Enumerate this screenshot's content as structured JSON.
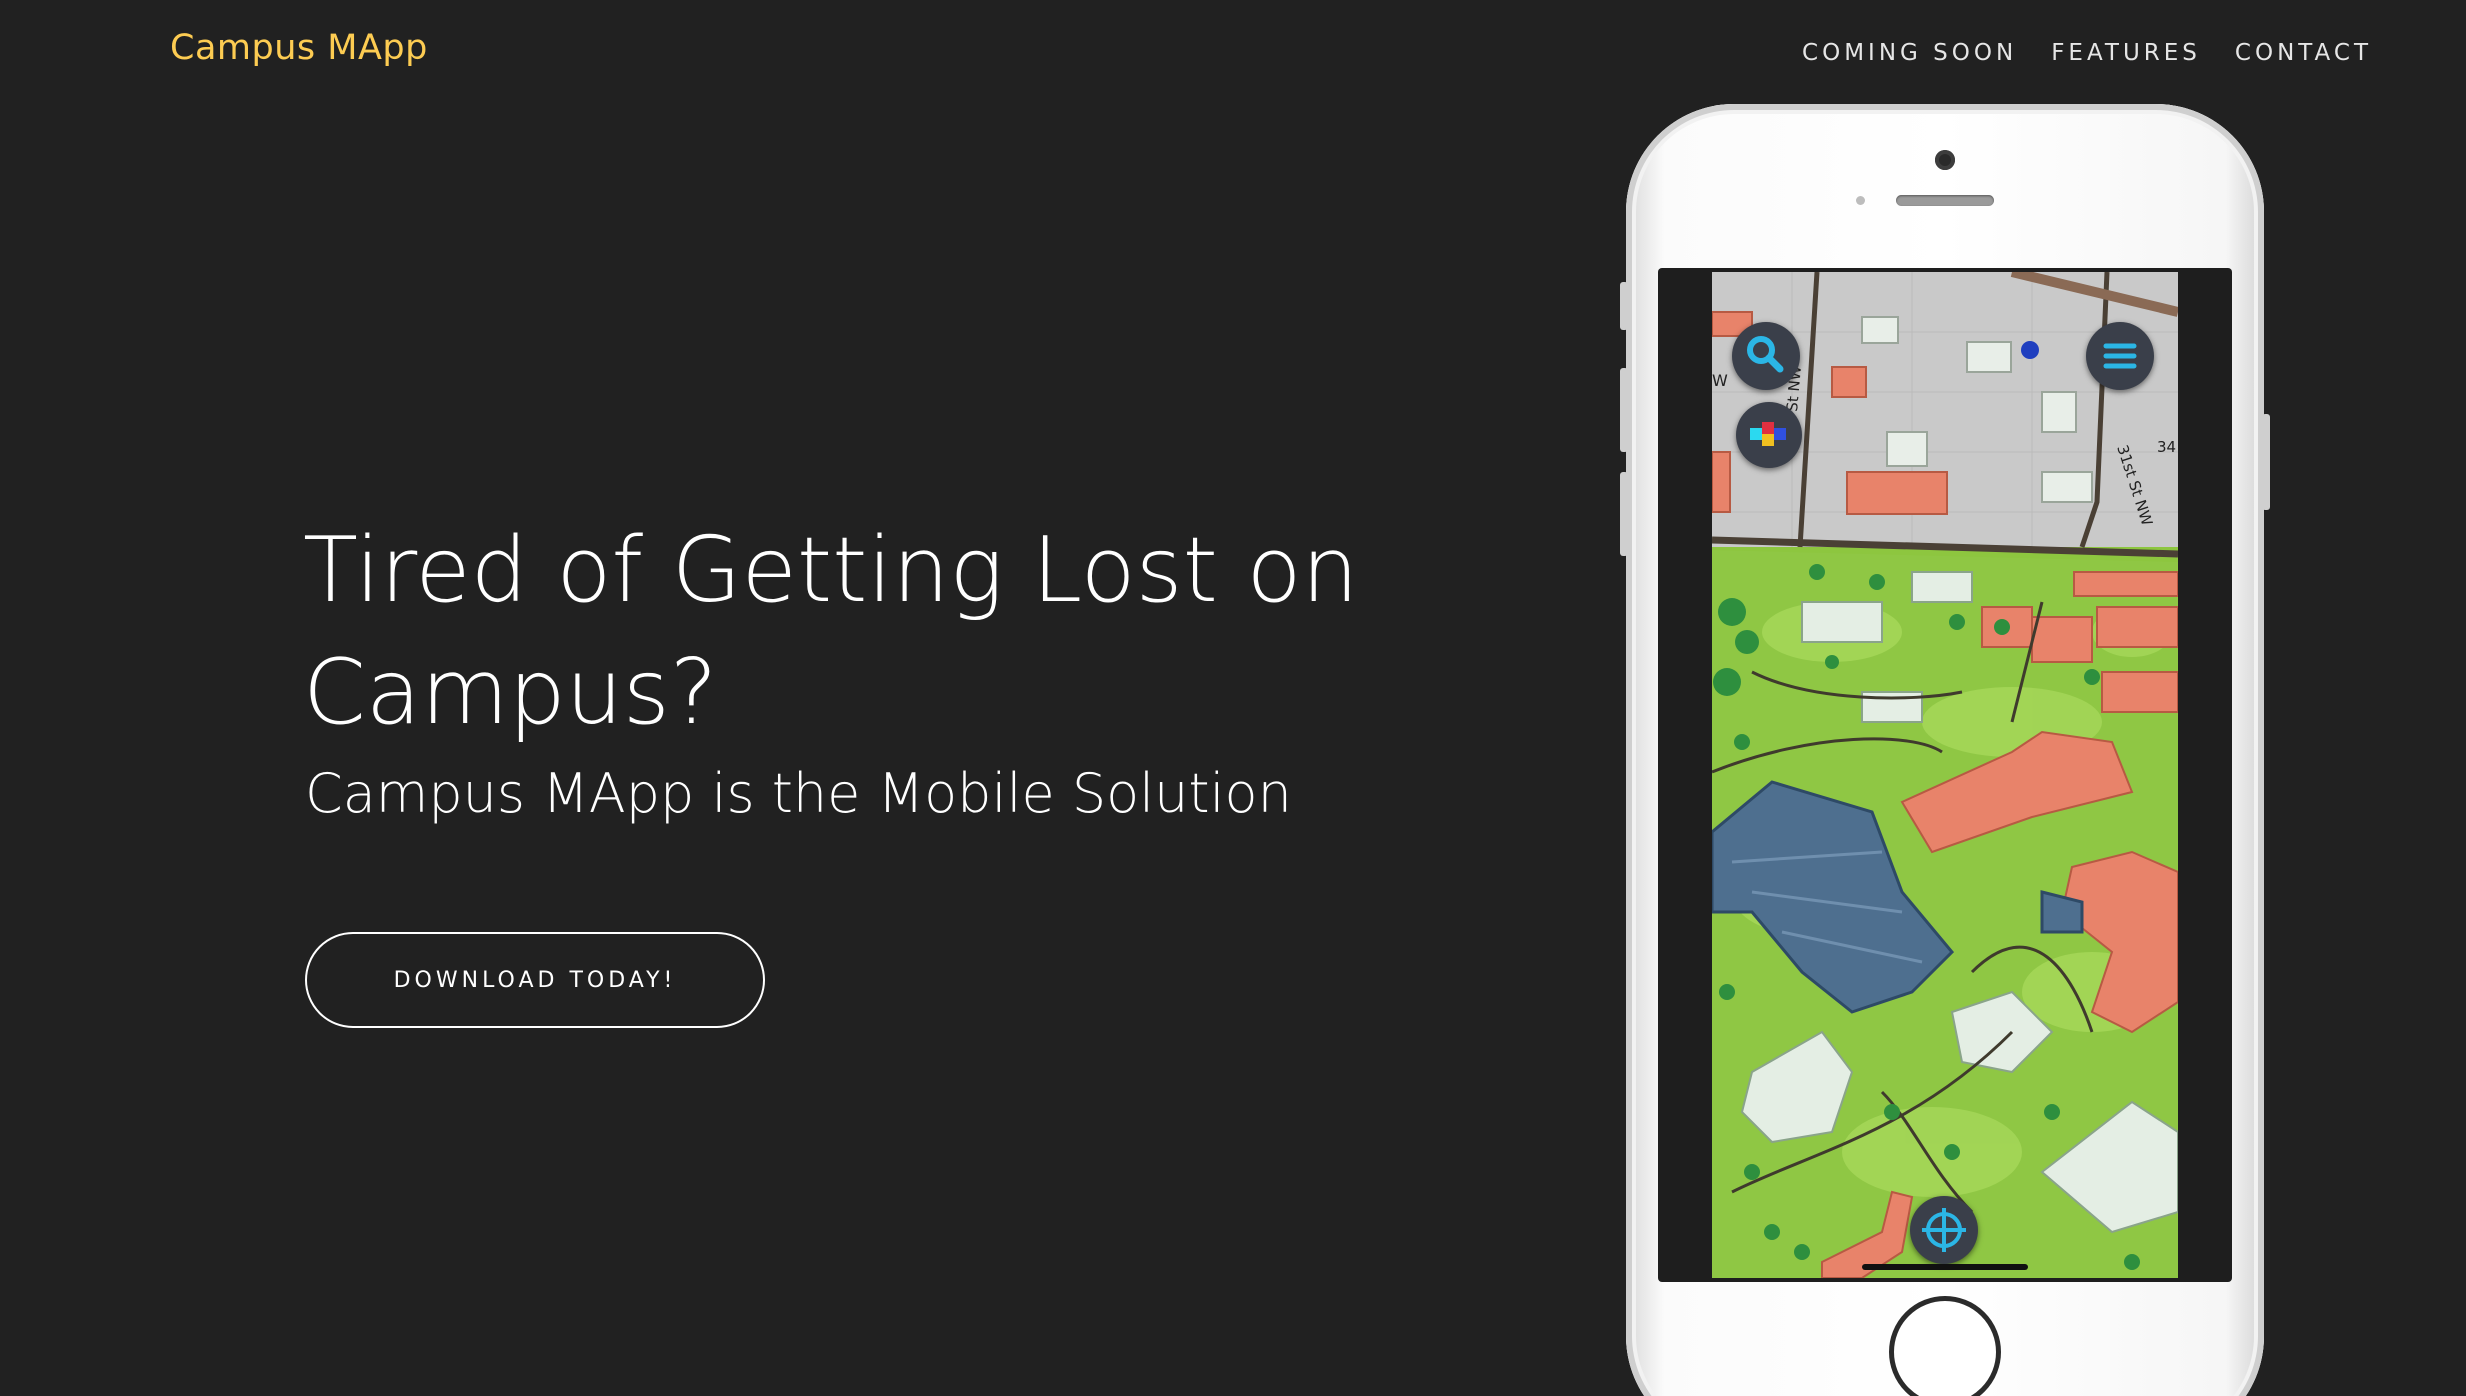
{
  "nav": {
    "brand": "Campus MApp",
    "links": [
      "COMING SOON",
      "FEATURES",
      "CONTACT"
    ]
  },
  "hero": {
    "title": "Tired of Getting Lost on Campus?",
    "subtitle": "Campus MApp is the Mobile Solution",
    "cta_label": "DOWNLOAD TODAY!"
  },
  "map": {
    "street_labels": [
      "W",
      "St NW",
      "31st St NW",
      "34"
    ]
  },
  "colors": {
    "background": "#212121",
    "brand": "#fdcc52",
    "text": "#ffffff",
    "map_grass": "#8dc63f",
    "map_roof_brick": "#e8836a",
    "map_roof_blue": "#4e6f8f",
    "map_icon_accent": "#2bb6e6"
  },
  "icons": {
    "search": "search-icon",
    "menu": "hamburger-menu-icon",
    "layers": "layers-icon",
    "locate": "crosshair-locate-icon"
  }
}
